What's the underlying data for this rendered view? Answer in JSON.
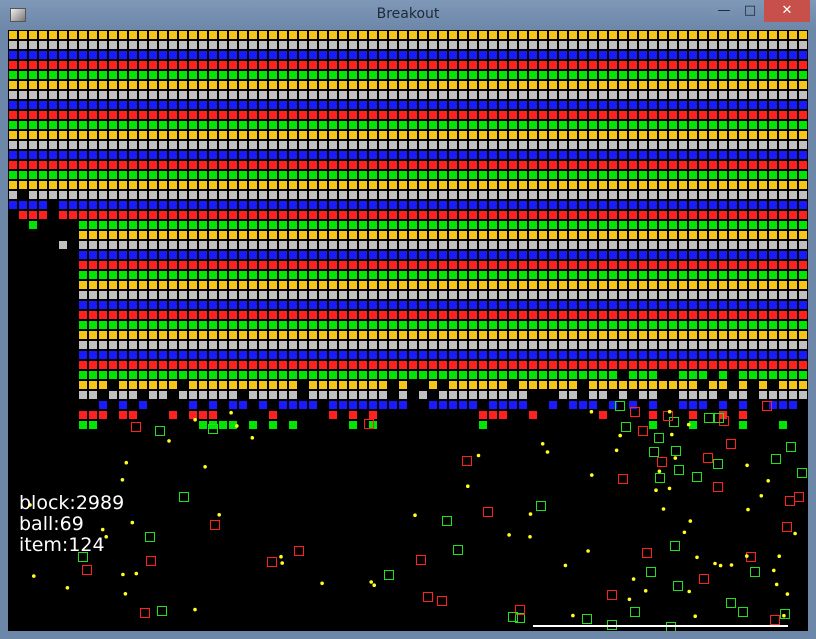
{
  "window": {
    "title": "Breakout",
    "controls": {
      "minimize": "—",
      "maximize": "□",
      "close": "✕"
    }
  },
  "colors": {
    "background": "#000000",
    "row_palette": [
      "#f5c518",
      "#c0c0c0",
      "#1a1aff",
      "#ff2020",
      "#00e600"
    ],
    "ball": "#ffff20",
    "item_red": "#ff2020",
    "item_green": "#20e020",
    "paddle": "#ffffff"
  },
  "stats": {
    "block": "block:2989",
    "ball": "ball:69",
    "item": "item:124"
  }
}
